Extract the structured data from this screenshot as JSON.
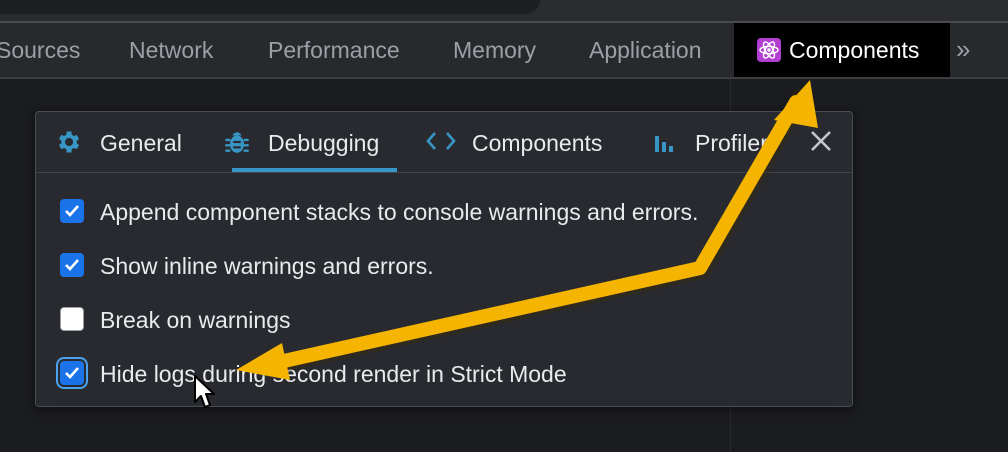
{
  "devtools_tabs": [
    {
      "label": "Sources"
    },
    {
      "label": "Network"
    },
    {
      "label": "Performance"
    },
    {
      "label": "Memory"
    },
    {
      "label": "Application"
    },
    {
      "label": "Components",
      "active": true
    }
  ],
  "overflow_label": "»",
  "settings": {
    "tabs": [
      {
        "label": "General",
        "icon": "gear-icon"
      },
      {
        "label": "Debugging",
        "icon": "bug-icon",
        "selected": true
      },
      {
        "label": "Components",
        "icon": "code-brackets-icon"
      },
      {
        "label": "Profiler",
        "icon": "bar-chart-icon"
      }
    ],
    "options": [
      {
        "label": "Append component stacks to console warnings and errors.",
        "checked": true
      },
      {
        "label": "Show inline warnings and errors.",
        "checked": true
      },
      {
        "label": "Break on warnings",
        "checked": false
      },
      {
        "label": "Hide logs during second render in Strict Mode",
        "checked": true,
        "focused": true
      }
    ]
  },
  "colors": {
    "accent": "#3796c6",
    "checkbox": "#1a73e8",
    "annotation_arrow": "#f5b400",
    "react_badge": "#b23fd1"
  }
}
